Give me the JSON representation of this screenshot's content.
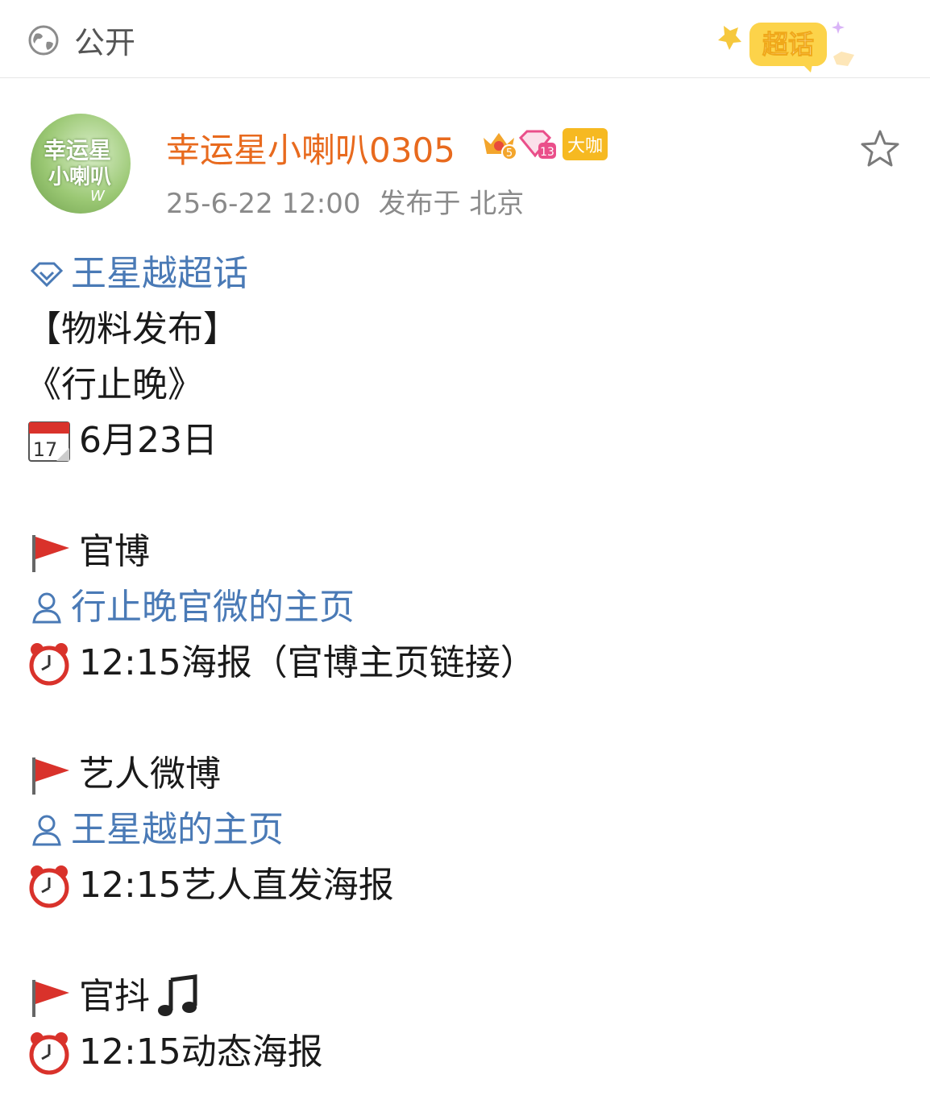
{
  "header": {
    "visibility_icon": "globe-icon",
    "visibility": "公开",
    "badge_icon": "chaohua-badge-icon",
    "badge_text": "超话"
  },
  "post": {
    "avatar": {
      "line1": "幸运星",
      "line2": "小喇叭",
      "line3": "W"
    },
    "username": "幸运星小喇叭0305",
    "badges": [
      "crown-level-icon",
      "diamond-level-icon"
    ],
    "crown_level": "5",
    "diamond_level": "13",
    "vip_label": "大咖",
    "time": "25-6-22 12:00",
    "location": "发布于 北京",
    "favorite_icon": "star-outline-icon",
    "content": {
      "topic": "王星越超话",
      "tag": "【物料发布】",
      "title": "《行止晚》",
      "date": "6月23日",
      "section1_heading": "官博",
      "section1_link": "行止晚官微的主页",
      "section1_item": "12:15海报（官博主页链接）",
      "section2_heading": "艺人微博",
      "section2_link": "王星越的主页",
      "section2_item": "12:15艺人直发海报",
      "section3_heading": "官抖",
      "section3_item": "12:15动态海报"
    },
    "colors": {
      "username": "#e86a1e",
      "link": "#4a7ab6",
      "meta": "#8a8a8a"
    }
  }
}
